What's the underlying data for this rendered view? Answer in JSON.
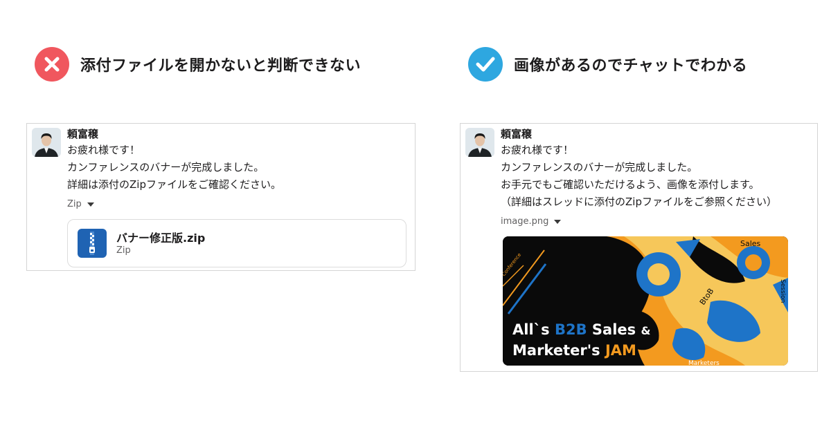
{
  "left_panel": {
    "heading": "添付ファイルを開かないと判断できない",
    "status_icon": "x-circle-icon",
    "status_color": "#f0575e",
    "sender": "頼富穣",
    "lines": [
      "お疲れ様です！",
      "カンファレンスのバナーが完成しました。",
      "詳細は添付のZipファイルをご確認ください。"
    ],
    "attachment_label": "Zip",
    "file": {
      "name": "バナー修正版.zip",
      "type": "Zip",
      "icon": "zip-file-icon"
    }
  },
  "right_panel": {
    "heading": "画像があるのでチャットでわかる",
    "status_icon": "check-circle-icon",
    "status_color": "#2ea7e0",
    "sender": "頼富穣",
    "lines": [
      "お疲れ様です！",
      "カンファレンスのバナーが完成しました。",
      "お手元でもご確認いただけるよう、画像を添付します。",
      "（詳細はスレッドに添付のZipファイルをご参照ください）"
    ],
    "attachment_label": "image.png",
    "banner": {
      "line1_prefix": "All`s ",
      "line1_accent": "B2B",
      "line1_suffix": " Sales ",
      "ampersand": "&",
      "line2_prefix": "Marketer's ",
      "line2_accent": "JAM",
      "tag_conference": "Conference",
      "tag_sales": "Sales",
      "tag_session": "Session",
      "tag_btob": "BtoB",
      "tag_marketers": "Marketers",
      "colors": {
        "blue": "#1e74c8",
        "orange": "#f39a1f",
        "yellow": "#f6c75a"
      }
    }
  }
}
